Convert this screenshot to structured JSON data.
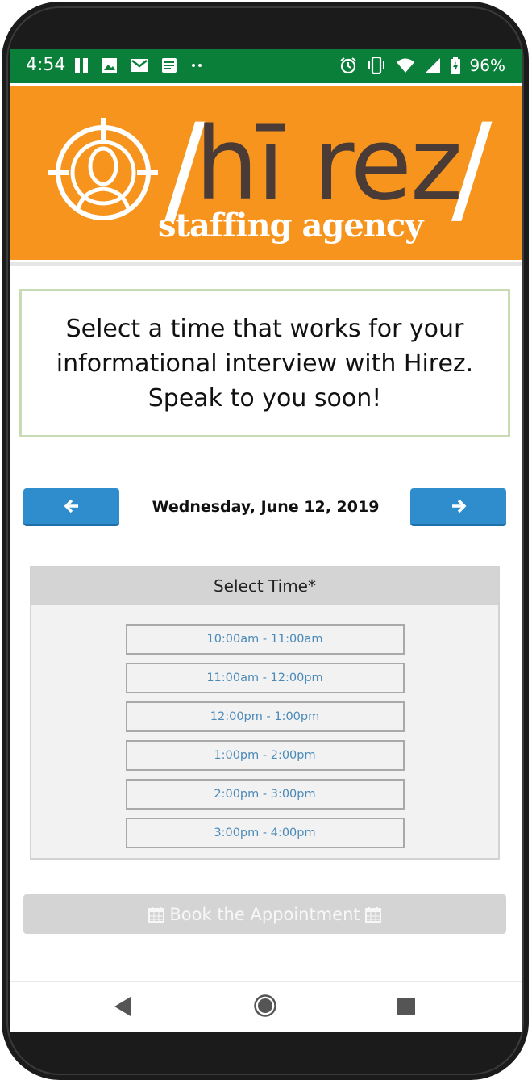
{
  "status_bar": {
    "time": "4:54",
    "battery": "96%",
    "icons_left": [
      "pause-icon",
      "image-icon",
      "gmail-icon",
      "document-icon",
      "more-dots-icon"
    ],
    "icons_right": [
      "alarm-icon",
      "vibrate-icon",
      "wifi-icon",
      "signal-icon",
      "battery-charging-icon"
    ]
  },
  "header": {
    "logo_slash_left": "/",
    "logo_main": "hī rez",
    "logo_slash_right": "/",
    "logo_sub": "staffing agency",
    "colors": {
      "background": "#f7941d",
      "logo_dark": "#4a3b37"
    }
  },
  "message": {
    "lines": [
      "Select a time that works for your",
      "informational interview with Hirez.",
      "Speak to you soon!"
    ]
  },
  "date_nav": {
    "date": "Wednesday, June 12, 2019",
    "prev_icon": "arrow-left-icon",
    "next_icon": "arrow-right-icon",
    "button_color": "#2f8ccd"
  },
  "time_panel": {
    "heading": "Select Time*",
    "slots": [
      "10:00am - 11:00am",
      "11:00am - 12:00pm",
      "12:00pm - 1:00pm",
      "1:00pm - 2:00pm",
      "2:00pm - 3:00pm",
      "3:00pm - 4:00pm"
    ]
  },
  "book_button": {
    "label": "Book the Appointment",
    "icon": "calendar-icon"
  },
  "nav_bar": {
    "icons": [
      "back-icon",
      "home-icon",
      "recents-icon"
    ]
  }
}
